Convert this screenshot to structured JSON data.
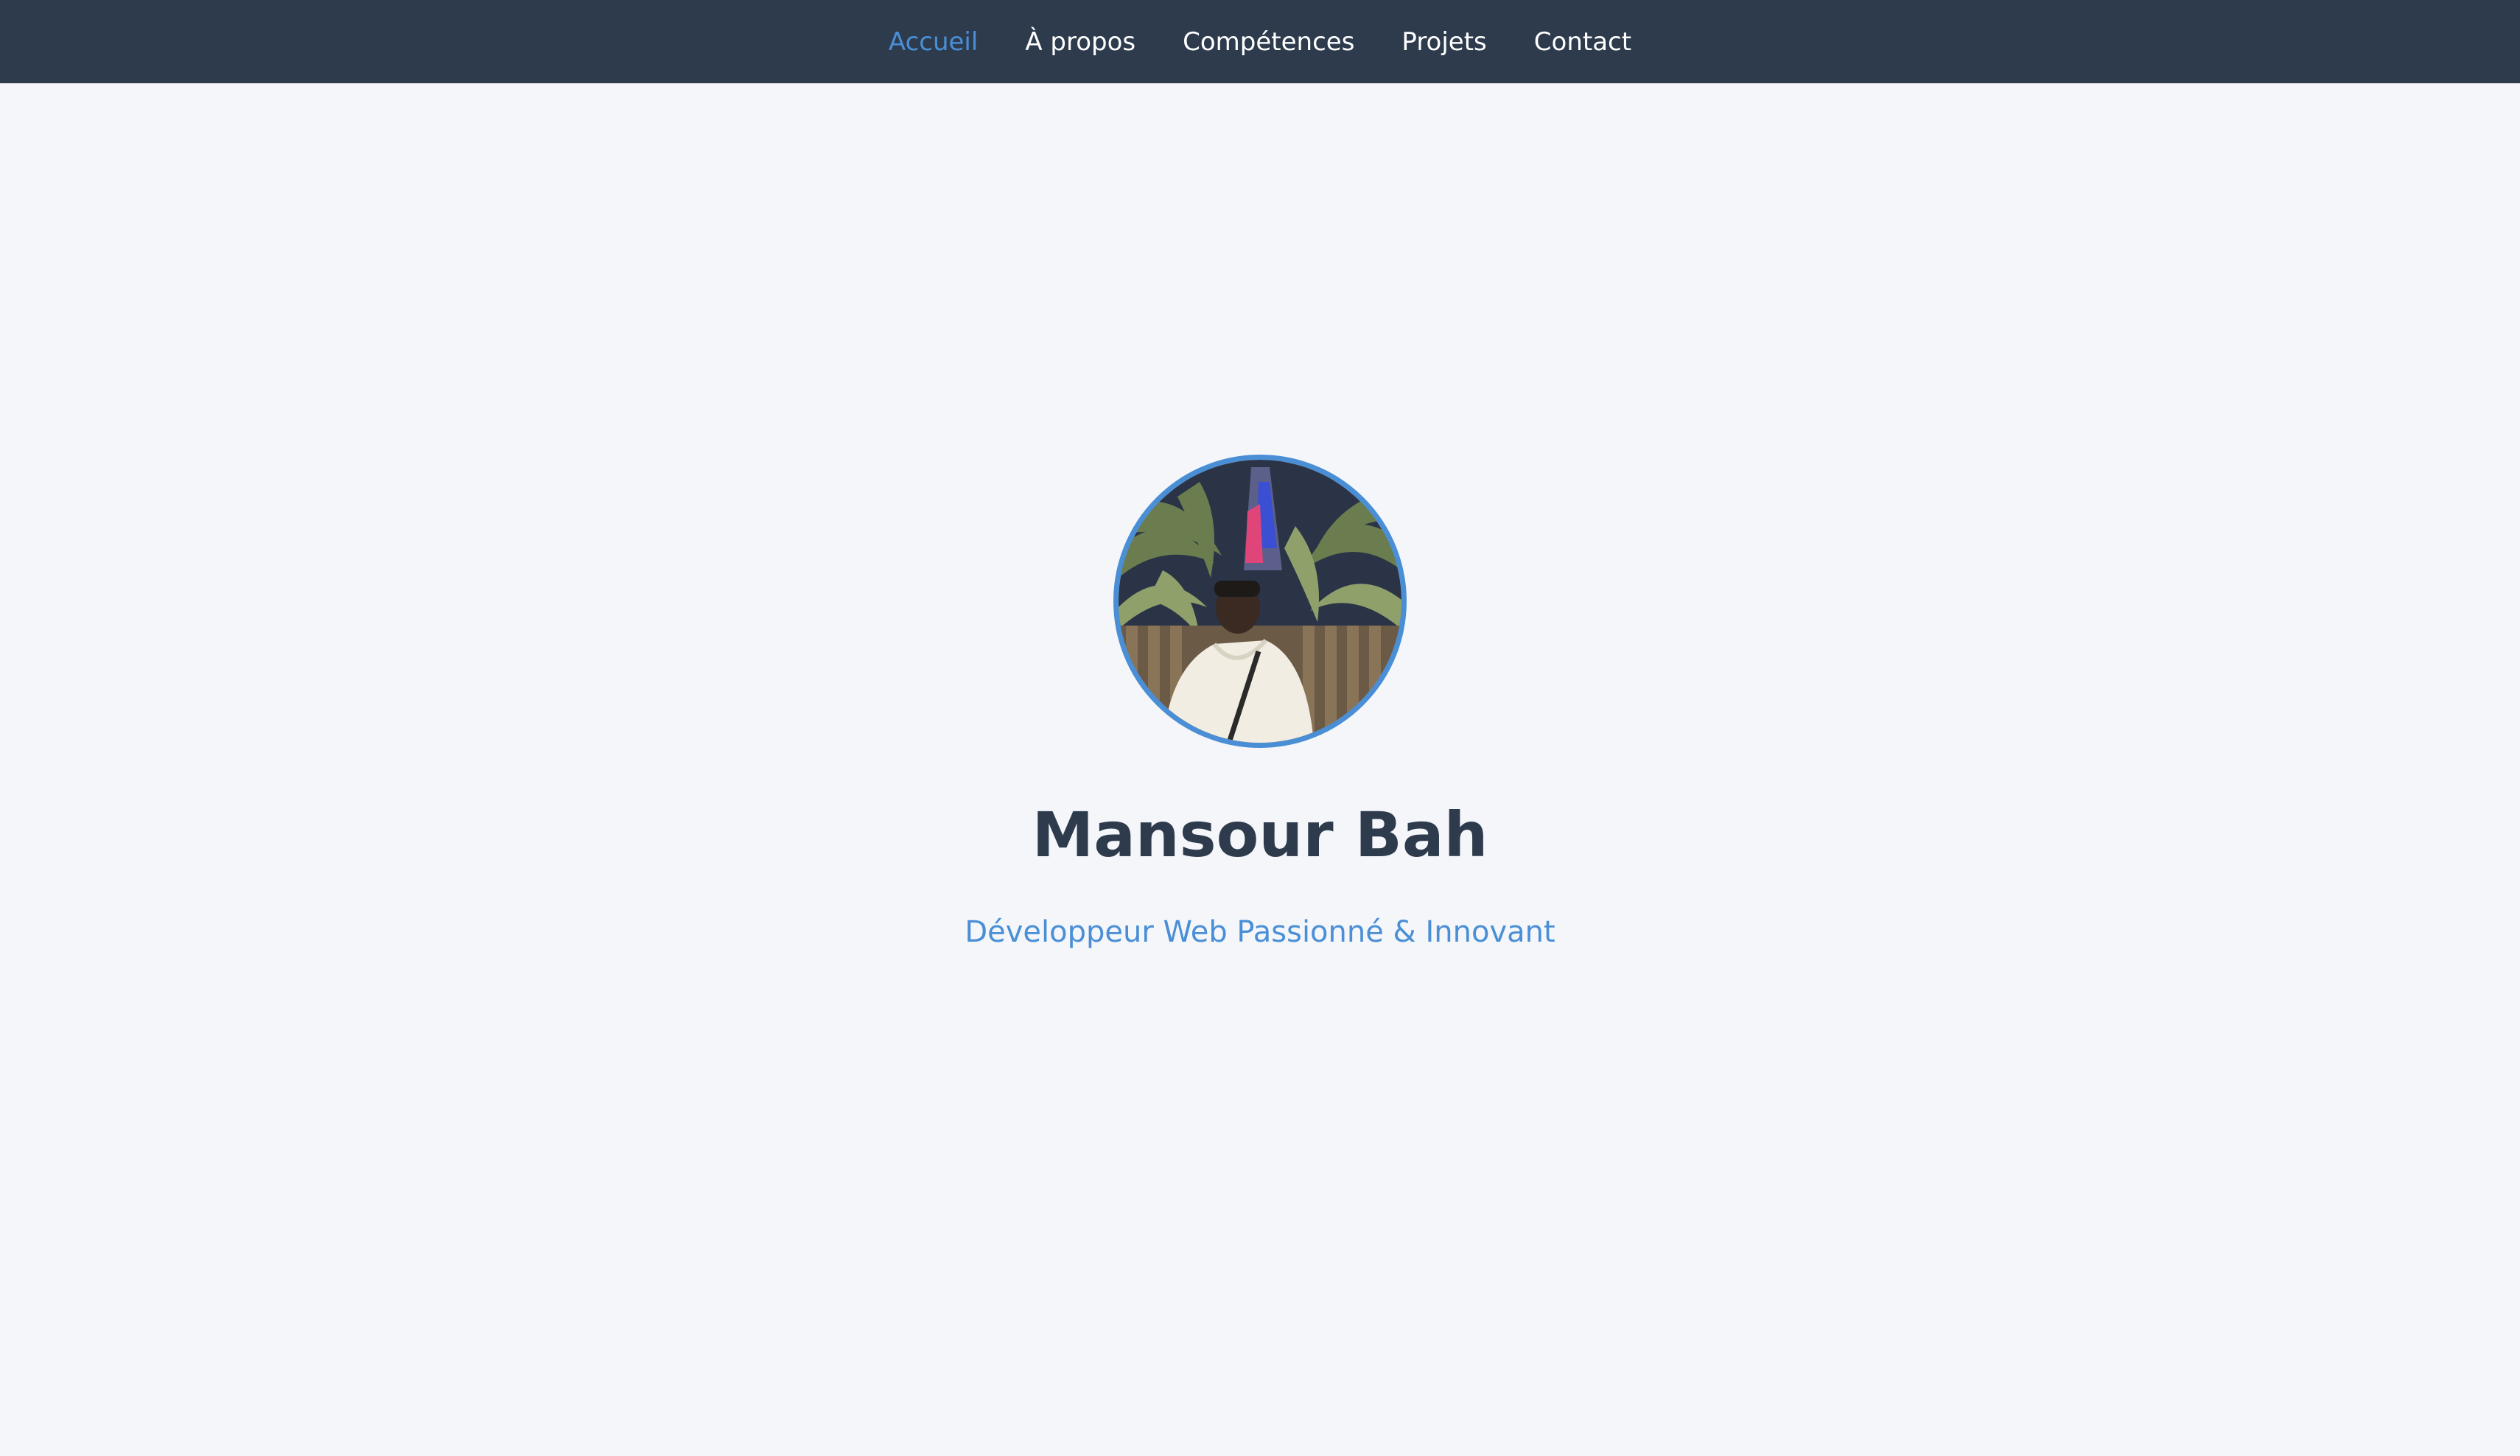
{
  "nav": {
    "items": [
      {
        "label": "Accueil",
        "active": true
      },
      {
        "label": "À propos",
        "active": false
      },
      {
        "label": "Compétences",
        "active": false
      },
      {
        "label": "Projets",
        "active": false
      },
      {
        "label": "Contact",
        "active": false
      }
    ]
  },
  "hero": {
    "name": "Mansour Bah",
    "tagline": "Développeur Web Passionné & Innovant",
    "avatar_icon": "profile-photo"
  },
  "colors": {
    "navbar_bg": "#2e3b4d",
    "page_bg": "#f4f6fa",
    "accent": "#4a8fd6",
    "heading": "#2e3b4d",
    "nav_text": "#ffffff"
  }
}
